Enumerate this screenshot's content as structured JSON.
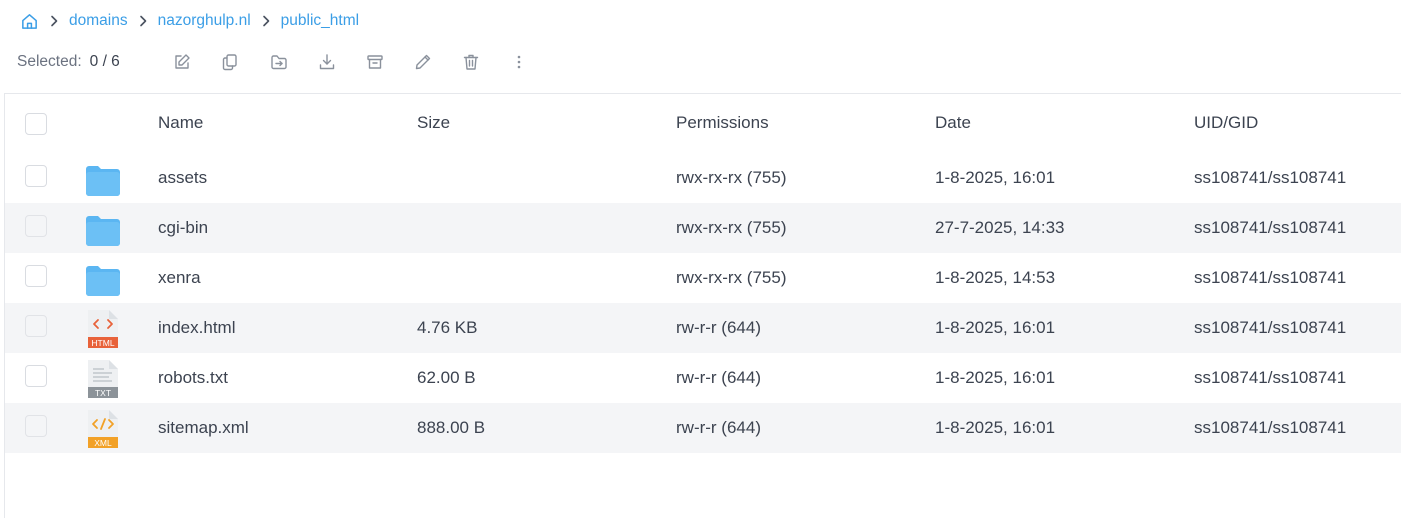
{
  "breadcrumb": {
    "home_icon": "home-icon",
    "items": [
      {
        "label": "domains"
      },
      {
        "label": "nazorghulp.nl"
      },
      {
        "label": "public_html"
      }
    ]
  },
  "toolbar": {
    "selected_label": "Selected:",
    "selected_count": "0 / 6",
    "tools": [
      "edit-icon",
      "copy-icon",
      "move-icon",
      "download-icon",
      "archive-icon",
      "rename-icon",
      "delete-icon",
      "more-icon"
    ]
  },
  "table": {
    "columns": {
      "name": "Name",
      "size": "Size",
      "permissions": "Permissions",
      "date": "Date",
      "uid": "UID/GID"
    },
    "rows": [
      {
        "type": "folder",
        "name": "assets",
        "size": "",
        "permissions": "rwx-rx-rx (755)",
        "date": "1-8-2025, 16:01",
        "uid": "ss108741/ss108741"
      },
      {
        "type": "folder",
        "name": "cgi-bin",
        "size": "",
        "permissions": "rwx-rx-rx (755)",
        "date": "27-7-2025, 14:33",
        "uid": "ss108741/ss108741"
      },
      {
        "type": "folder",
        "name": "xenra",
        "size": "",
        "permissions": "rwx-rx-rx (755)",
        "date": "1-8-2025, 14:53",
        "uid": "ss108741/ss108741"
      },
      {
        "type": "html",
        "badge": "HTML",
        "name": "index.html",
        "size": "4.76 KB",
        "permissions": "rw-r-r (644)",
        "date": "1-8-2025, 16:01",
        "uid": "ss108741/ss108741"
      },
      {
        "type": "txt",
        "badge": "TXT",
        "name": "robots.txt",
        "size": "62.00 B",
        "permissions": "rw-r-r (644)",
        "date": "1-8-2025, 16:01",
        "uid": "ss108741/ss108741"
      },
      {
        "type": "xml",
        "badge": "XML",
        "name": "sitemap.xml",
        "size": "888.00 B",
        "permissions": "rw-r-r (644)",
        "date": "1-8-2025, 16:01",
        "uid": "ss108741/ss108741"
      }
    ]
  },
  "colors": {
    "link": "#3b9ee6",
    "folder": "#5bb6f2",
    "html": "#e8623a",
    "txt": "#8c9399",
    "xml": "#f2a127",
    "row_alt": "#f4f5f7"
  }
}
